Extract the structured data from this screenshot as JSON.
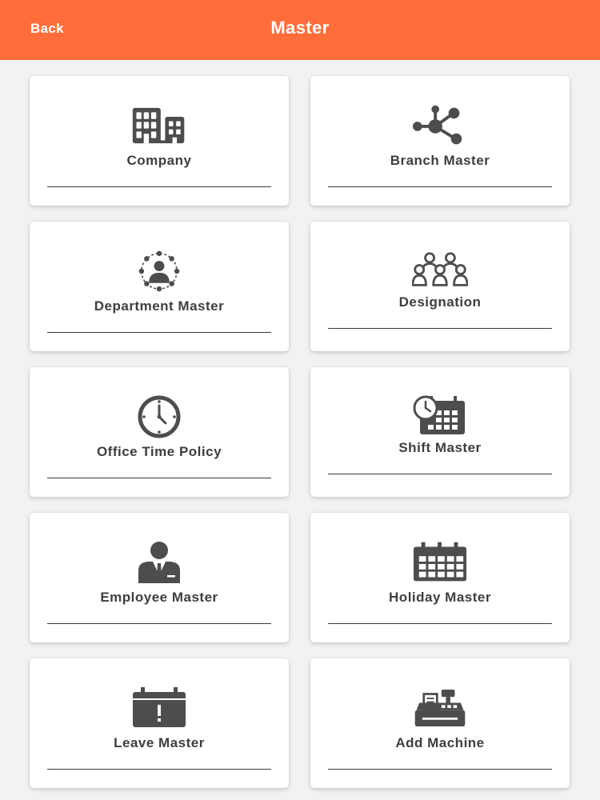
{
  "header": {
    "back_label": "Back",
    "title": "Master",
    "background_color": "#fe6d3a"
  },
  "tiles": [
    {
      "label": "Company",
      "icon": "buildings-icon"
    },
    {
      "label": "Branch Master",
      "icon": "network-nodes-icon"
    },
    {
      "label": "Department Master",
      "icon": "department-people-icon"
    },
    {
      "label": "Designation",
      "icon": "group-people-icon"
    },
    {
      "label": "Office Time Policy",
      "icon": "clock-icon"
    },
    {
      "label": "Shift Master",
      "icon": "calendar-clock-icon"
    },
    {
      "label": "Employee Master",
      "icon": "employee-suit-icon"
    },
    {
      "label": "Holiday Master",
      "icon": "calendar-icon"
    },
    {
      "label": "Leave Master",
      "icon": "calendar-alert-icon"
    },
    {
      "label": "Add Machine",
      "icon": "cash-register-icon"
    }
  ]
}
